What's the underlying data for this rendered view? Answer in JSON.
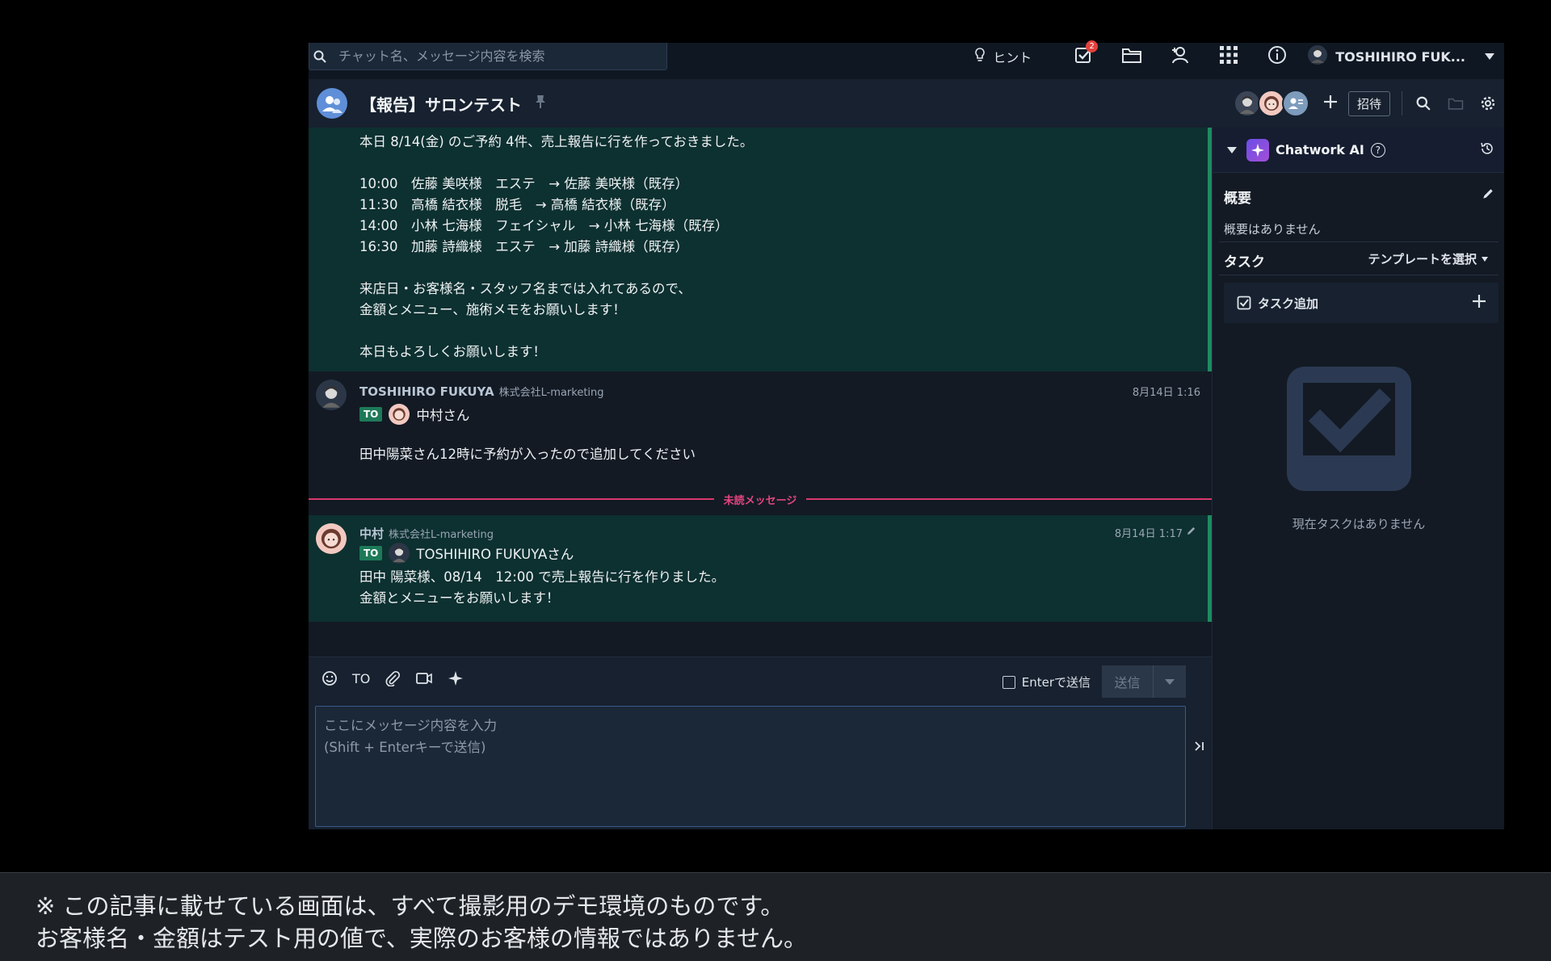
{
  "search": {
    "placeholder": "チャット名、メッセージ内容を検索"
  },
  "topbar": {
    "hint_label": "ヒント",
    "task_badge": "2",
    "user_name": "TOSHIHIRO FUK..."
  },
  "room": {
    "title": "【報告】サロンテスト",
    "invite_label": "招待"
  },
  "messages": {
    "first_body": "本日 8/14(金) のご予約 4件、売上報告に行を作っておきました。\n\n10:00　佐藤 美咲様　エステ　→ 佐藤 美咲様（既存）\n11:30　高橋 結衣様　脱毛　→ 高橋 結衣様（既存）\n14:00　小林 七海様　フェイシャル　→ 小林 七海様（既存）\n16:30　加藤 詩織様　エステ　→ 加藤 詩織様（既存）\n\n来店日・お客様名・スタッフ名までは入れてあるので、\n金額とメニュー、施術メモをお願いします！\n\n本日もよろしくお願いします！",
    "second": {
      "sender": "TOSHIHIRO FUKUYA",
      "org": "株式会社L-marketing",
      "time": "8月14日 1:16",
      "to_label": "TO",
      "to_name": "中村さん",
      "text": "田中陽菜さん12時に予約が入ったので追加してください"
    },
    "unread_label": "未読メッセージ",
    "third": {
      "sender": "中村",
      "org": "株式会社L-marketing",
      "time": "8月14日 1:17",
      "to_label": "TO",
      "to_name": "TOSHIHIRO FUKUYAさん",
      "text": "田中 陽菜様、08/14　12:00 で売上報告に行を作りました。\n金額とメニューをお願いします！"
    }
  },
  "composer": {
    "to_tool": "TO",
    "enter_send_label": "Enterで送信",
    "send_label": "送信",
    "placeholder": "ここにメッセージ内容を入力\n(Shift + Enterキーで送信)"
  },
  "panel": {
    "ai_title": "Chatwork AI",
    "summary_title": "概要",
    "summary_empty": "概要はありません",
    "task_title": "タスク",
    "template_label": "テンプレートを選択",
    "task_add_label": "タスク追加",
    "no_task": "現在タスクはありません"
  },
  "note": {
    "line1": "※ この記事に載せている画面は、すべて撮影用のデモ環境のものです。",
    "line2": "お客様名・金額はテスト用の値で、実際のお客様の情報ではありません。"
  },
  "colors": {
    "accent_green": "#1f8a61",
    "unread_pink": "#d9386e",
    "badge_red": "#e3413b",
    "message_bg": "#0d3030"
  }
}
